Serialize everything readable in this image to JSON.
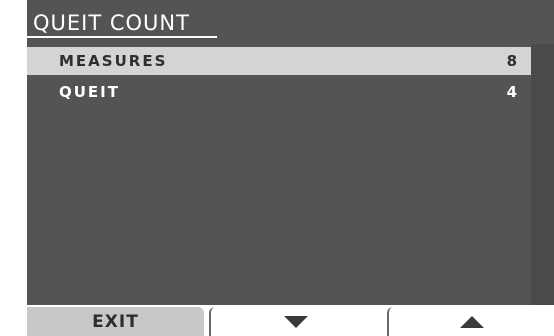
{
  "screen": {
    "title": "QUEIT COUNT"
  },
  "list": {
    "items": [
      {
        "label": "MEASURES",
        "value": "8",
        "selected": true
      },
      {
        "label": "QUEIT",
        "value": "4",
        "selected": false
      }
    ]
  },
  "softkeys": {
    "exit_label": "EXIT",
    "down_icon": "triangle-down-icon",
    "up_icon": "triangle-up-icon"
  },
  "colors": {
    "background": "#545454",
    "selected_row": "#d4d4d4",
    "text": "#ffffff"
  }
}
